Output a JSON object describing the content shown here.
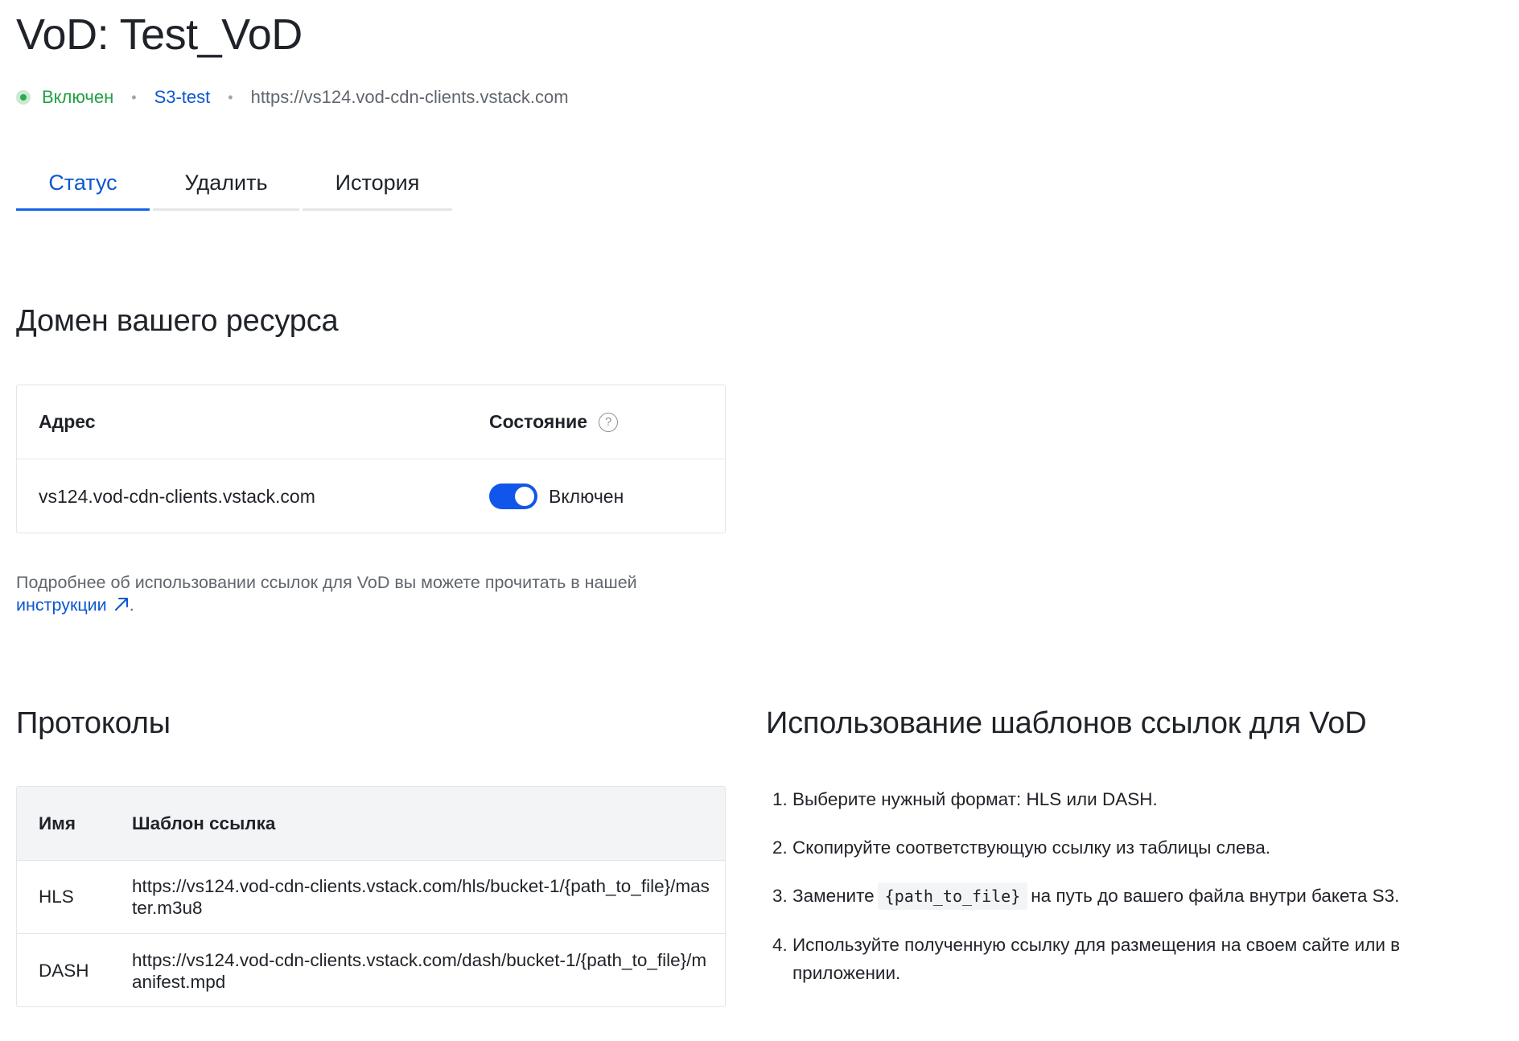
{
  "page": {
    "title": "VoD: Test_VoD"
  },
  "meta": {
    "status": "Включен",
    "bucket": "S3-test",
    "url": "https://vs124.vod-cdn-clients.vstack.com",
    "status_color": "#20a043",
    "link_color": "#0b57d0"
  },
  "tabs": [
    {
      "label": "Статус",
      "active": true
    },
    {
      "label": "Удалить",
      "active": false
    },
    {
      "label": "История",
      "active": false
    }
  ],
  "domain_section": {
    "title": "Домен вашего ресурса",
    "headers": {
      "address": "Адрес",
      "state": "Состояние"
    },
    "row": {
      "address": "vs124.vod-cdn-clients.vstack.com",
      "toggle_on": true,
      "state_label": "Включен"
    }
  },
  "info": {
    "text": "Подробнее об использовании ссылок для VoD вы можете прочитать в нашей",
    "link": "инструкции",
    "suffix": "."
  },
  "protocols_section": {
    "title": "Протоколы",
    "headers": {
      "name": "Имя",
      "template": "Шаблон ссылка"
    },
    "rows": [
      {
        "name": "HLS",
        "template": "https://vs124.vod-cdn-clients.vstack.com/hls/bucket-1/{path_to_file}/master.m3u8"
      },
      {
        "name": "DASH",
        "template": "https://vs124.vod-cdn-clients.vstack.com/dash/bucket-1/{path_to_file}/manifest.mpd"
      }
    ]
  },
  "guide_section": {
    "title": "Использование шаблонов ссылок для VoD",
    "steps": [
      {
        "text": "Выберите нужный формат: HLS или DASH."
      },
      {
        "text": "Скопируйте соответствующую ссылку из таблицы слева."
      },
      {
        "before": "Замените",
        "code": "{path_to_file}",
        "after": "на путь до вашего файла внутри бакета S3."
      },
      {
        "text": "Используйте полученную ссылку для размещения на своем сайте или в приложении."
      }
    ]
  }
}
